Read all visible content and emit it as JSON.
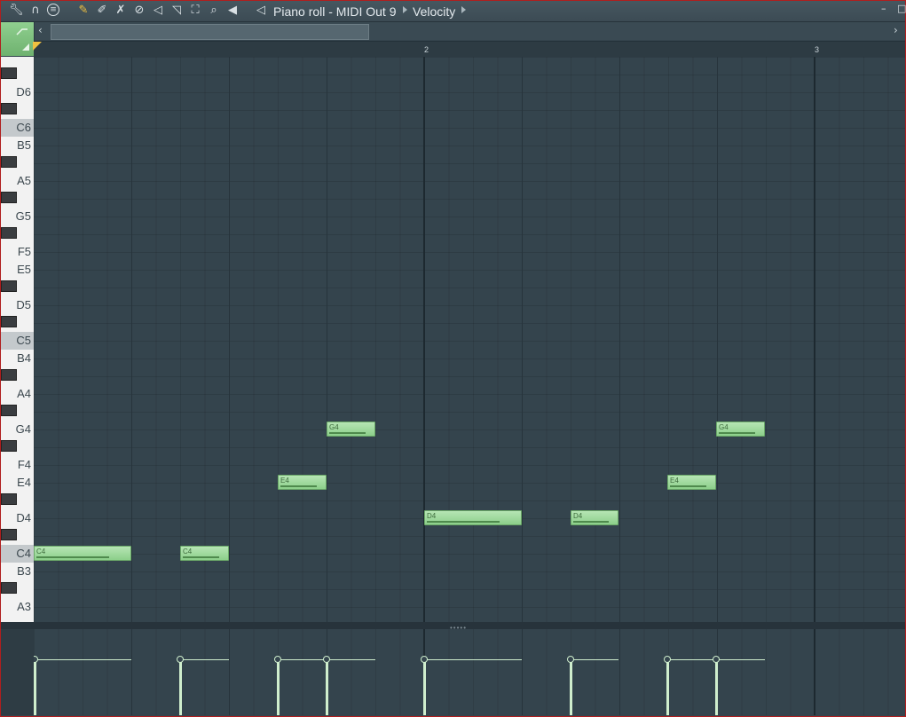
{
  "window": {
    "title": "Piano roll - MIDI Out 9",
    "target": "Velocity"
  },
  "toolbar": {
    "icons": [
      "wrench-icon",
      "magnet-icon",
      "menu-icon",
      "pencil-icon",
      "brush-icon",
      "delete-icon",
      "mute-icon",
      "slice-icon",
      "select-icon",
      "zoom-icon",
      "playback-icon",
      "speaker-icon"
    ]
  },
  "ruler": {
    "bars": [
      "2",
      "3"
    ]
  },
  "keyboard": {
    "labels": [
      "D6",
      "C6",
      "B5",
      "A5",
      "G5",
      "F5",
      "E5",
      "D5",
      "C5",
      "B4",
      "A4",
      "G4",
      "F4",
      "E4",
      "D4",
      "C4",
      "B3",
      "A3"
    ]
  },
  "notes": [
    {
      "label": "C4"
    },
    {
      "label": "C4"
    },
    {
      "label": "E4"
    },
    {
      "label": "G4"
    },
    {
      "label": "D4"
    },
    {
      "label": "D4"
    },
    {
      "label": "E4"
    },
    {
      "label": "G4"
    }
  ],
  "colors": {
    "accent": "#8ccf8a",
    "background": "#34444d",
    "frame": "#b01e1e"
  }
}
